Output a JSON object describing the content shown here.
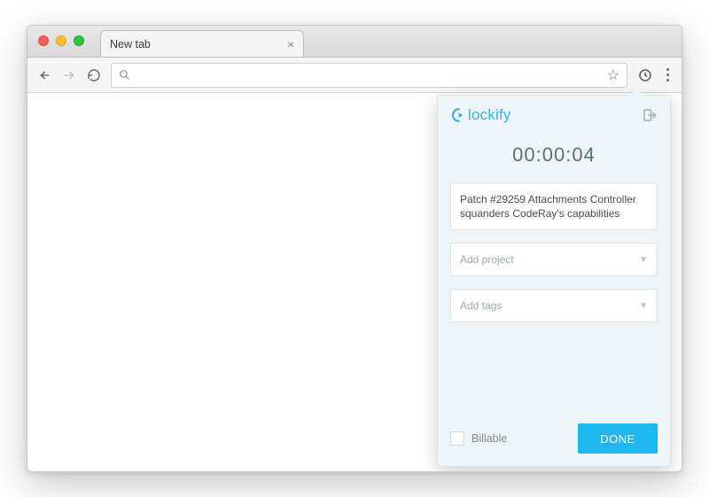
{
  "browser": {
    "tab_title": "New tab",
    "omnibox_value": ""
  },
  "popup": {
    "brand": "lockify",
    "timer": "00:00:04",
    "description": "Patch #29259 Attachments Controller squanders CodeRay's capabilities",
    "project_placeholder": "Add project",
    "tags_placeholder": "Add tags",
    "billable_label": "Billable",
    "done_label": "DONE"
  },
  "colors": {
    "accent": "#1fb6f2",
    "panel_bg": "#eef5f9"
  }
}
